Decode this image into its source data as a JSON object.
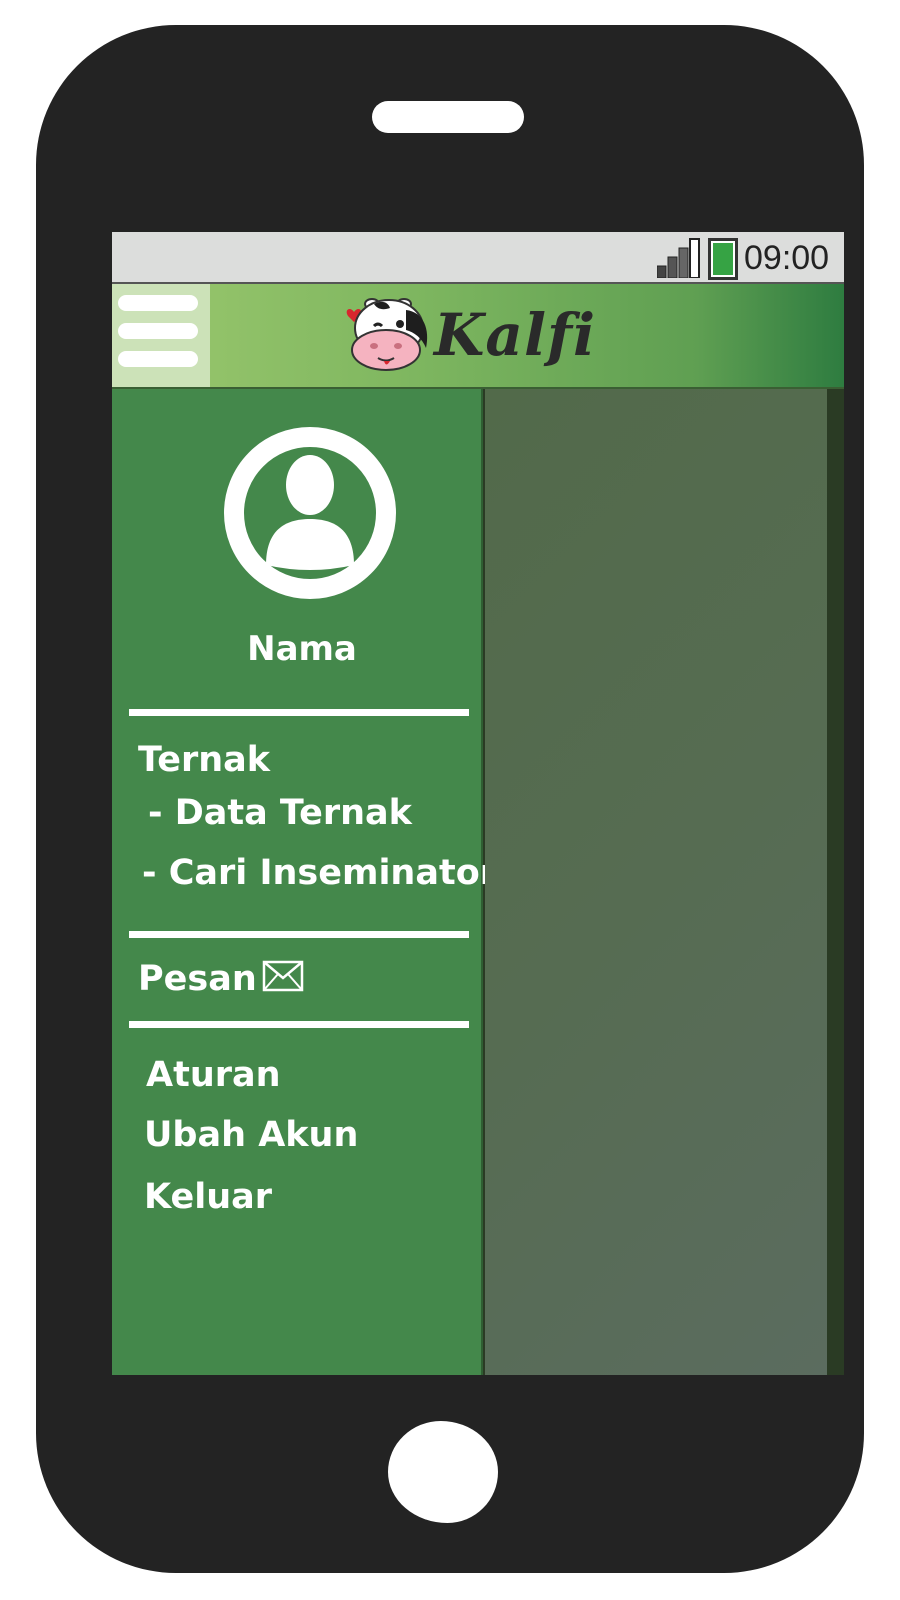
{
  "status_bar": {
    "time": "09:00",
    "signal_icon": "signal-bars-icon",
    "battery_icon": "battery-icon",
    "battery_color": "#36a344"
  },
  "app_bar": {
    "menu_icon": "hamburger-menu-icon",
    "logo_icon": "cow-mascot-icon",
    "brand": "Kalfi"
  },
  "drawer": {
    "avatar_icon": "user-avatar-icon",
    "user_name": "Nama",
    "section_ternak": {
      "title": "Ternak",
      "items": [
        "- Data Ternak",
        "- Cari Inseminator"
      ]
    },
    "pesan": {
      "label": "Pesan",
      "icon": "mail-icon"
    },
    "bottom_items": [
      "Aturan",
      "Ubah Akun",
      "Keluar"
    ]
  },
  "colors": {
    "drawer_bg": "#44884b",
    "app_bar_start": "#9cc86e",
    "app_bar_end": "#2e7c40",
    "phone_body": "#232323"
  }
}
